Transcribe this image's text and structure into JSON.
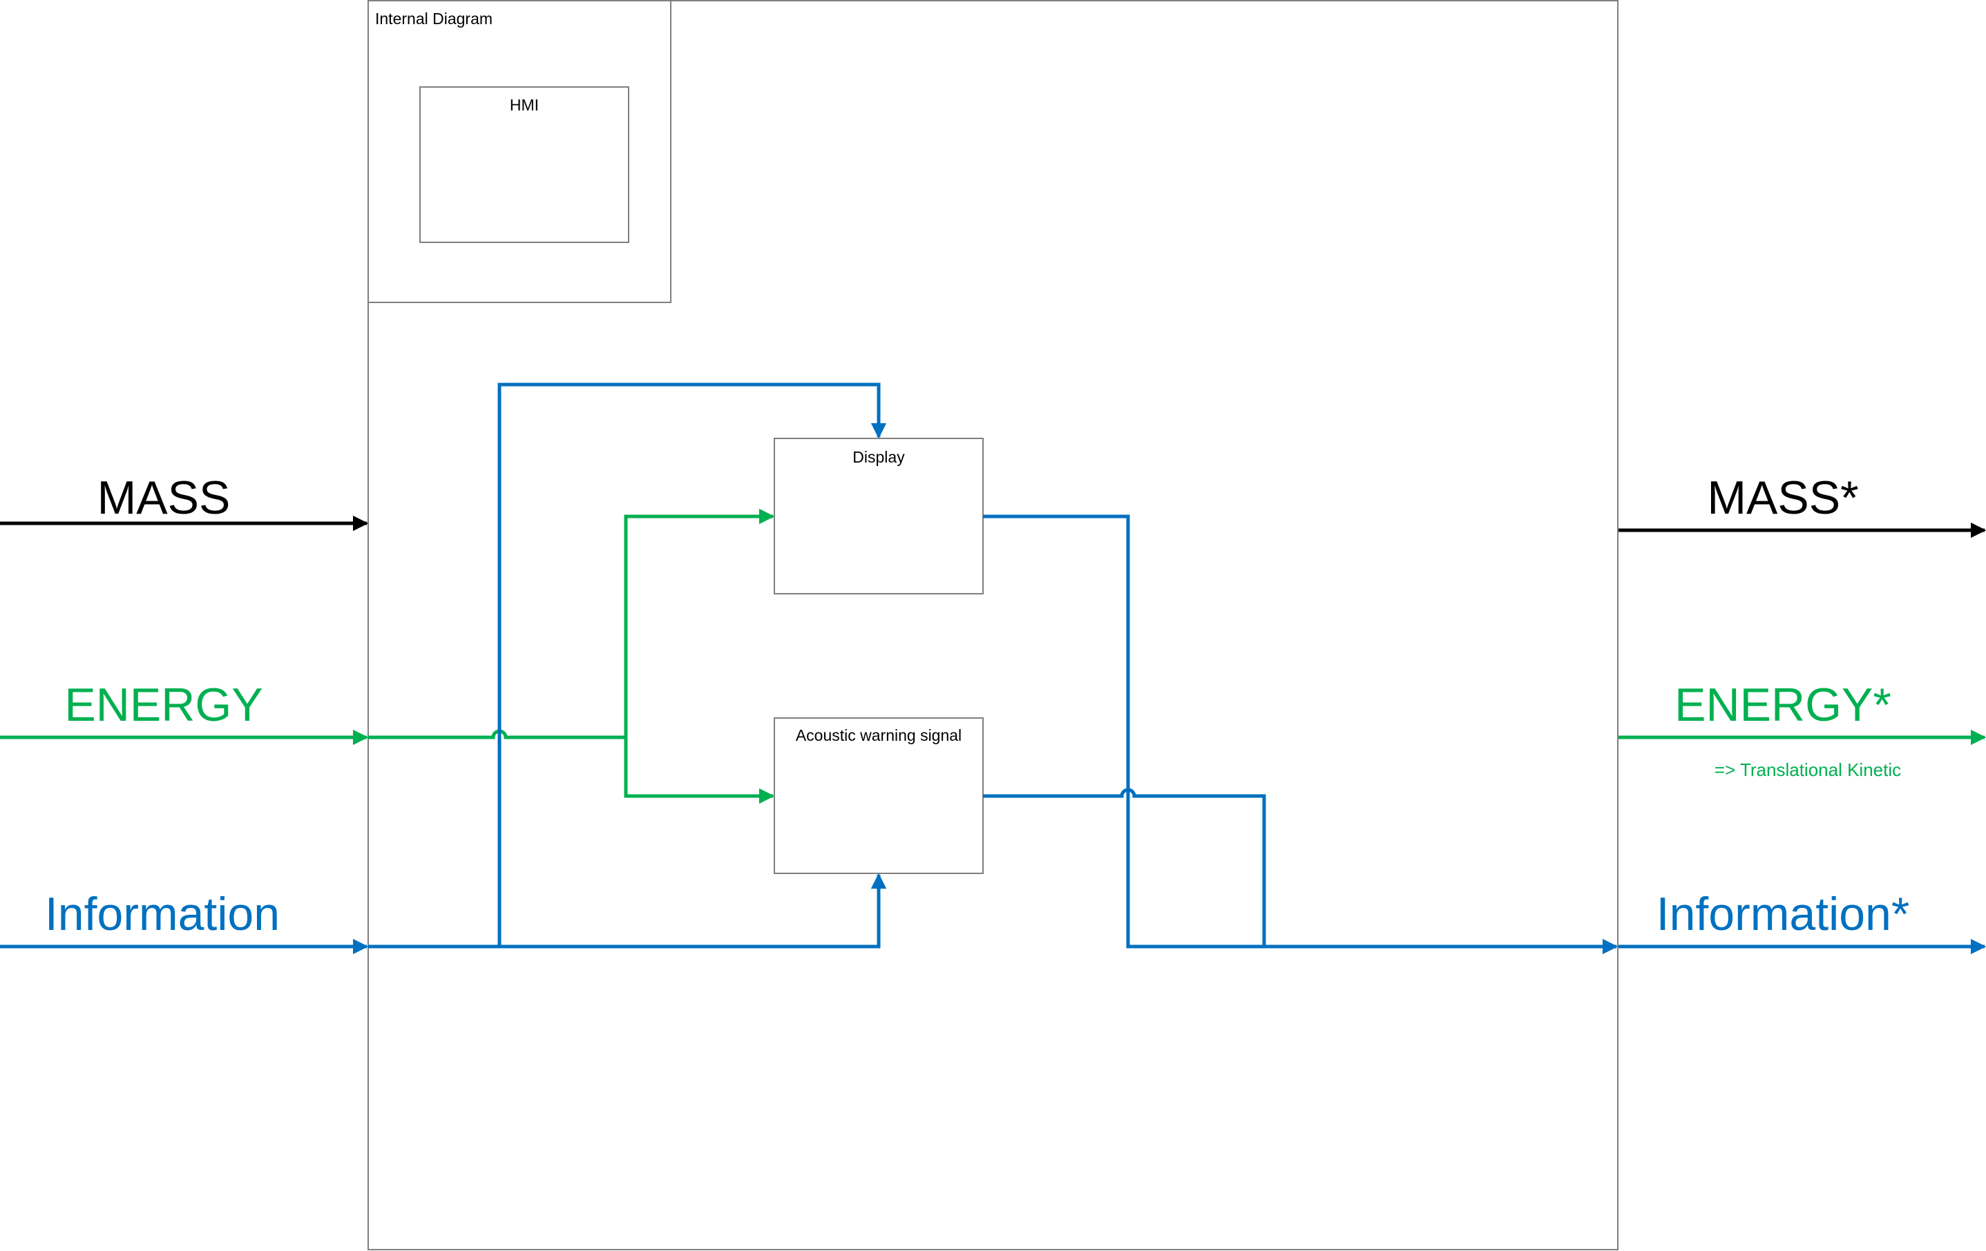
{
  "colors": {
    "mass": "#000000",
    "energy": "#00b050",
    "information": "#0070c0",
    "border": "#7f7f7f"
  },
  "boxes": {
    "internal_diagram": "Internal Diagram",
    "hmi": "HMI",
    "display": "Display",
    "acoustic": "Acoustic warning signal"
  },
  "inputs": {
    "mass": "MASS",
    "energy": "ENERGY",
    "information": "Information"
  },
  "outputs": {
    "mass": "MASS*",
    "energy": "ENERGY*",
    "energy_note": "=> Translational Kinetic",
    "information": "Information*"
  }
}
